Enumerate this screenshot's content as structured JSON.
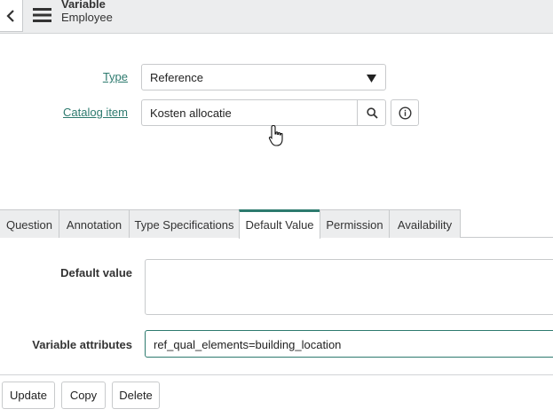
{
  "header": {
    "title_line1": "Variable",
    "title_line2": "Employee",
    "back_icon": "chevron-left-icon",
    "menu_icon": "hamburger-icon"
  },
  "form": {
    "type": {
      "label": "Type",
      "value": "Reference"
    },
    "catalog_item": {
      "label": "Catalog item",
      "value": "Kosten allocatie"
    }
  },
  "tabs": [
    {
      "label": "Question",
      "active": false
    },
    {
      "label": "Annotation",
      "active": false
    },
    {
      "label": "Type Specifications",
      "active": false
    },
    {
      "label": "Default Value",
      "active": true
    },
    {
      "label": "Permission",
      "active": false
    },
    {
      "label": "Availability",
      "active": false
    }
  ],
  "default_value_tab": {
    "default_value_label": "Default value",
    "default_value": "",
    "variable_attributes_label": "Variable attributes",
    "variable_attributes_value": "ref_qual_elements=building_location"
  },
  "actions": {
    "update": "Update",
    "copy": "Copy",
    "delete": "Delete"
  },
  "colors": {
    "accent": "#2d7a6e",
    "header_bg": "#ecedee",
    "border": "#c8cacc"
  }
}
